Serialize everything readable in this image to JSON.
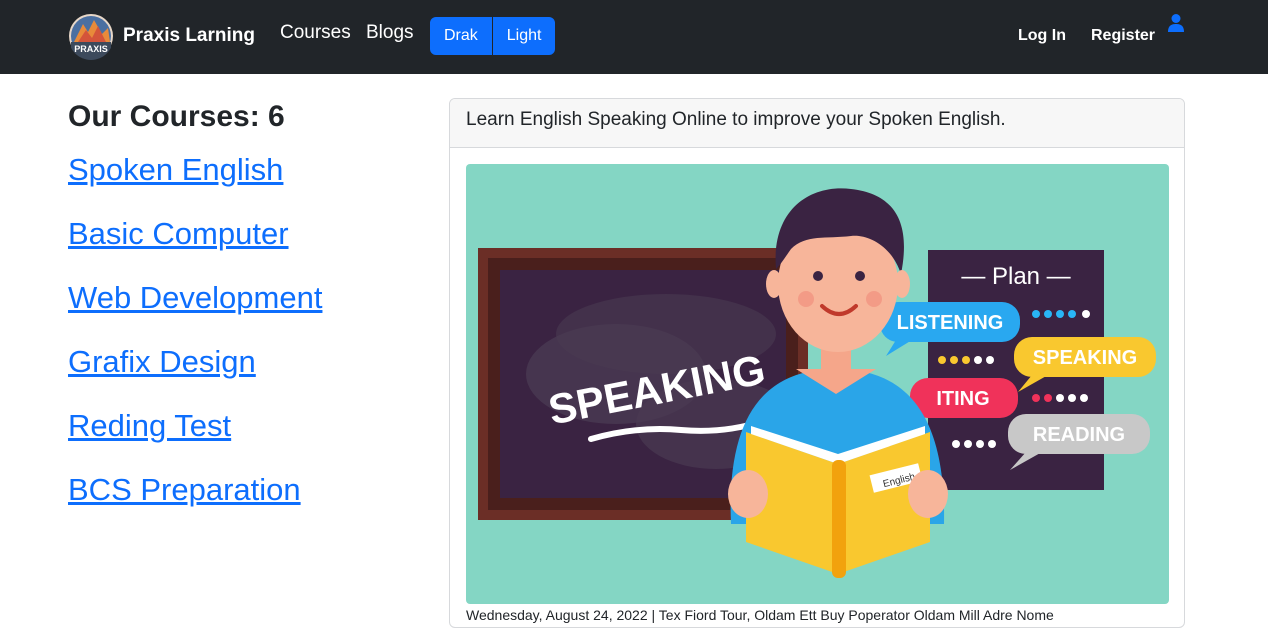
{
  "brand": {
    "name": "Praxis Larning",
    "logo_text": "PRAXIS"
  },
  "nav": {
    "courses": "Courses",
    "blogs": "Blogs"
  },
  "theme": {
    "dark_label": "Drak",
    "light_label": "Light"
  },
  "auth": {
    "login": "Log In",
    "register": "Register"
  },
  "sidebar": {
    "heading": "Our Courses: 6",
    "courses": [
      "Spoken English",
      "Basic Computer",
      "Web Development",
      "Grafix Design",
      "Reding Test",
      "BCS Preparation"
    ]
  },
  "card": {
    "header": "Learn English Speaking Online to improve your Spoken English.",
    "meta": "Wednesday, August 24, 2022 | Tex Fiord Tour, Oldam Ett Buy Poperator Oldam Mill Adre Nome",
    "image_text": {
      "board": "SPEAKING",
      "plan": "— Plan —",
      "listening": "LISTENING",
      "speaking": "SPEAKING",
      "writing": "ITING",
      "reading": "READING",
      "book": "English"
    }
  },
  "colors": {
    "navbar": "#212529",
    "primary": "#0d6efd",
    "image_bg": "#84d6c4"
  }
}
